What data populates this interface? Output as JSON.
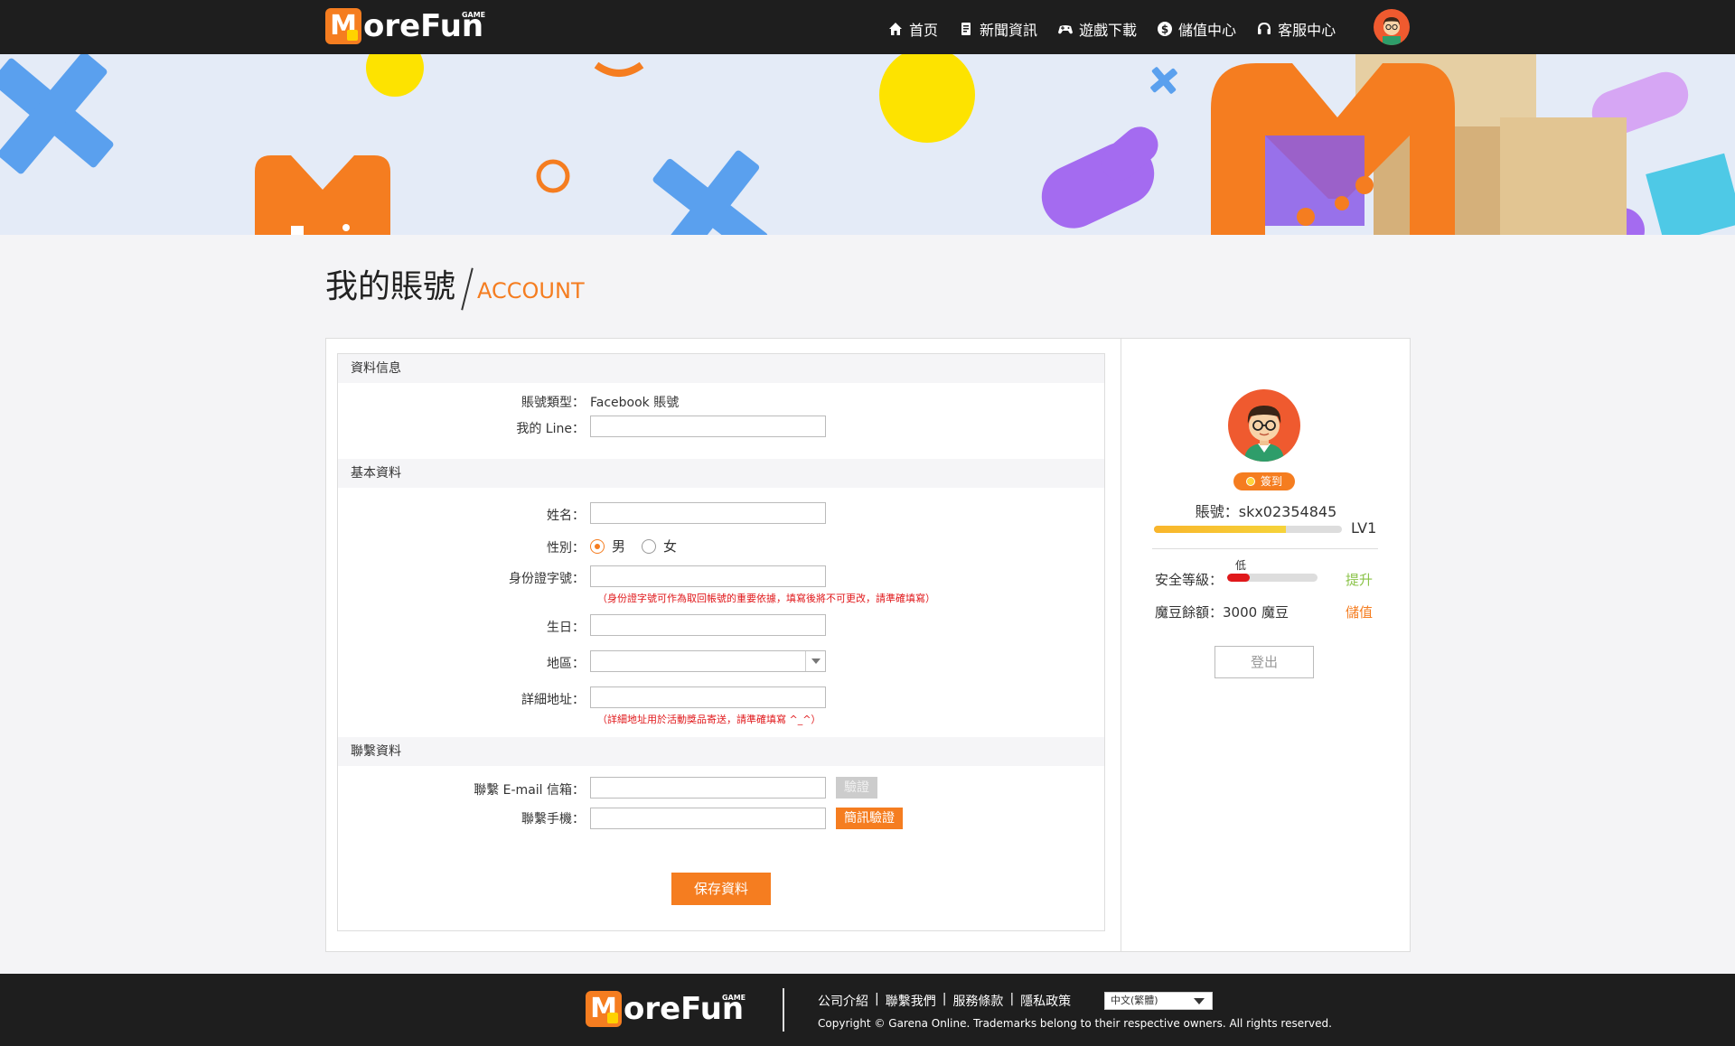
{
  "header": {
    "logo_text": "oreFun",
    "logo_badge": "GAME",
    "nav": [
      {
        "label": "首页",
        "icon": "home-icon"
      },
      {
        "label": "新聞資訊",
        "icon": "news-icon"
      },
      {
        "label": "遊戲下載",
        "icon": "gamepad-icon"
      },
      {
        "label": "儲值中心",
        "icon": "dollar-icon"
      },
      {
        "label": "客服中心",
        "icon": "headset-icon"
      }
    ]
  },
  "page": {
    "title_zh": "我的賬號",
    "title_en": "ACCOUNT"
  },
  "form": {
    "section_info": "資料信息",
    "account_type_label": "賬號類型：",
    "account_type_value": "Facebook 賬號",
    "line_label": "我的 Line：",
    "line_value": "",
    "section_basic": "基本資料",
    "name_label": "姓名：",
    "name_value": "",
    "gender_label": "性別：",
    "gender_male": "男",
    "gender_female": "女",
    "gender_selected": "男",
    "id_label": "身份證字號：",
    "id_value": "",
    "id_note": "（身份證字號可作為取回帳號的重要依據，填寫後將不可更改，請準確填寫）",
    "birthday_label": "生日：",
    "birthday_value": "",
    "region_label": "地區：",
    "region_value": "",
    "address_label": "詳細地址：",
    "address_value": "",
    "address_note": "（詳細地址用於活動獎品寄送，請準確填寫 ^_^）",
    "section_contact": "聯繫資料",
    "email_label": "聯繫 E-mail 信箱：",
    "email_value": "",
    "email_verify": "驗證",
    "phone_label": "聯繫手機：",
    "phone_value": "",
    "phone_verify": "簡訊驗證",
    "save_label": "保存資料"
  },
  "profile": {
    "checkin_label": "簽到",
    "account_label": "賬號：skx02354845",
    "level": "LV1",
    "level_progress": 0.7,
    "security_label": "安全等級：",
    "security_level": "低",
    "security_progress": 0.25,
    "security_action": "提升",
    "balance_label": "魔豆餘額：",
    "balance_value": "3000 魔豆",
    "balance_action": "儲值",
    "logout_label": "登出"
  },
  "footer": {
    "logo_text": "oreFun",
    "logo_badge": "GAME",
    "links": [
      "公司介紹",
      "聯繫我們",
      "服務條款",
      "隱私政策"
    ],
    "separator": "|",
    "language": "中文(繁體)",
    "copyright": "Copyright © Garena Online. Trademarks belong to their respective owners. All rights reserved."
  },
  "colors": {
    "brand_orange": "#f57d20",
    "header_bg": "#1e1e1e",
    "note_red": "#e0181b",
    "link_green": "#8bc34a"
  }
}
